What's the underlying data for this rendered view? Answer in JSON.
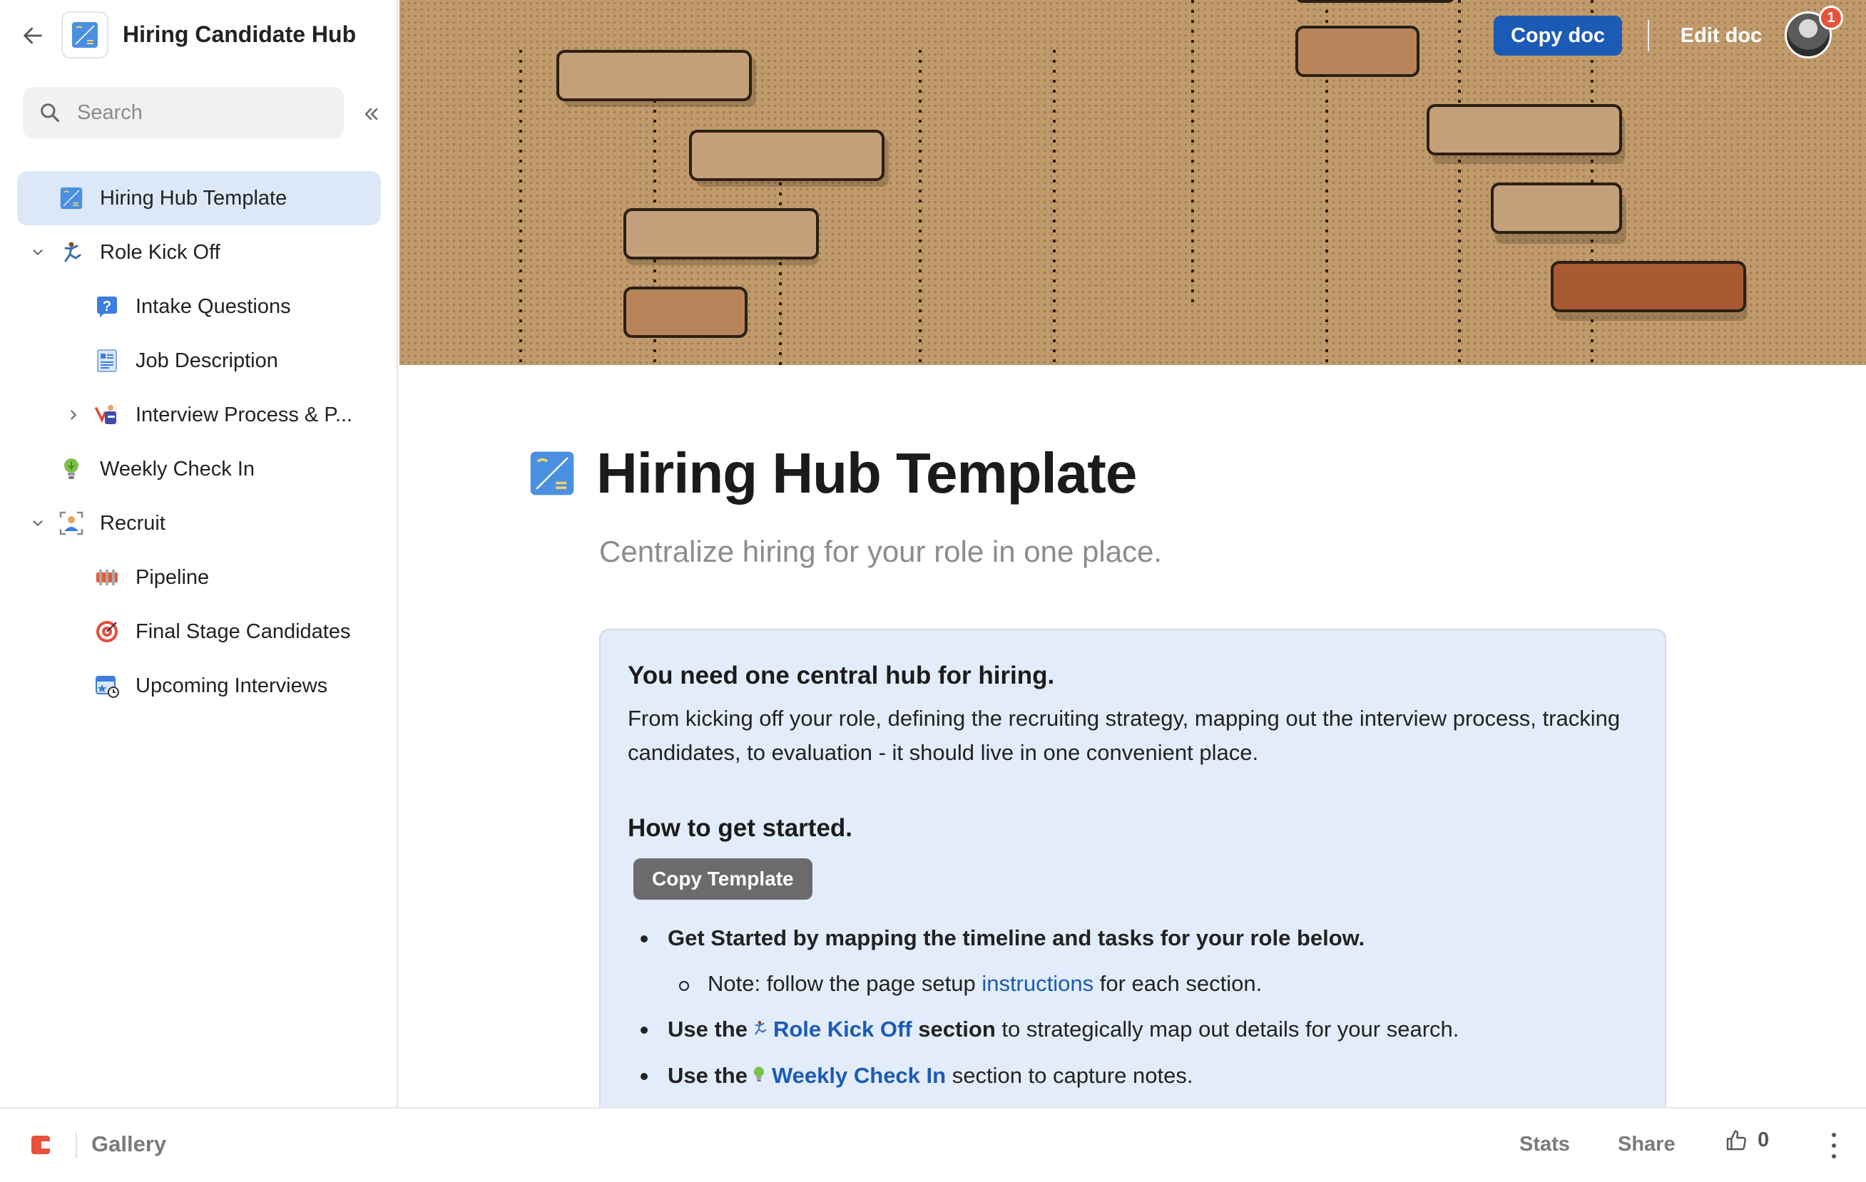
{
  "sidebar": {
    "doc_title": "Hiring Candidate Hub",
    "search_placeholder": "Search",
    "items": [
      {
        "label": "Hiring Hub Template",
        "icon": "blueprint-icon",
        "active": true
      },
      {
        "label": "Role Kick Off",
        "icon": "kicking-person-icon",
        "expanded": true
      },
      {
        "label": "Intake Questions",
        "icon": "question-icon"
      },
      {
        "label": "Job Description",
        "icon": "document-icon"
      },
      {
        "label": "Interview Process & P...",
        "icon": "interview-icon",
        "expanded": false
      },
      {
        "label": "Weekly Check In",
        "icon": "lightbulb-icon"
      },
      {
        "label": "Recruit",
        "icon": "person-frame-icon",
        "expanded": true
      },
      {
        "label": "Pipeline",
        "icon": "pipeline-icon"
      },
      {
        "label": "Final Stage Candidates",
        "icon": "target-icon"
      },
      {
        "label": "Upcoming Interviews",
        "icon": "calendar-clock-icon"
      }
    ]
  },
  "header": {
    "copy_doc_label": "Copy doc",
    "edit_doc_label": "Edit doc",
    "notification_count": "1"
  },
  "page": {
    "title": "Hiring Hub Template",
    "subtitle": "Centralize hiring for your role in one place.",
    "callout": {
      "heading": "You need one central hub for hiring.",
      "body": "From kicking off your role, defining the recruiting strategy, mapping out the interview process, tracking candidates, to evaluation - it should live in one convenient place.",
      "started_heading": "How to get started.",
      "copy_template_label": "Copy Template",
      "bullet1": "Get Started by mapping the timeline and tasks for your role below.",
      "sub_note_prefix": "Note: follow the page setup ",
      "sub_note_link": "instructions",
      "sub_note_suffix": " for each section.",
      "bullet2_prefix": "Use the",
      "bullet2_link": "Role Kick Off",
      "bullet2_bold": "section",
      "bullet2_suffix": " to strategically map out details for your search.",
      "bullet3_prefix": "Use the",
      "bullet3_link": "Weekly Check In",
      "bullet3_suffix": " section to capture notes."
    }
  },
  "footer": {
    "gallery_label": "Gallery",
    "stats_label": "Stats",
    "share_label": "Share",
    "likes_count": "0"
  },
  "colors": {
    "accent": "#1c5bb5",
    "active_nav_bg": "#dce8f7",
    "callout_bg": "#e3ecfa",
    "banner": "#c19a6b",
    "coda_brand": "#e8513c"
  }
}
